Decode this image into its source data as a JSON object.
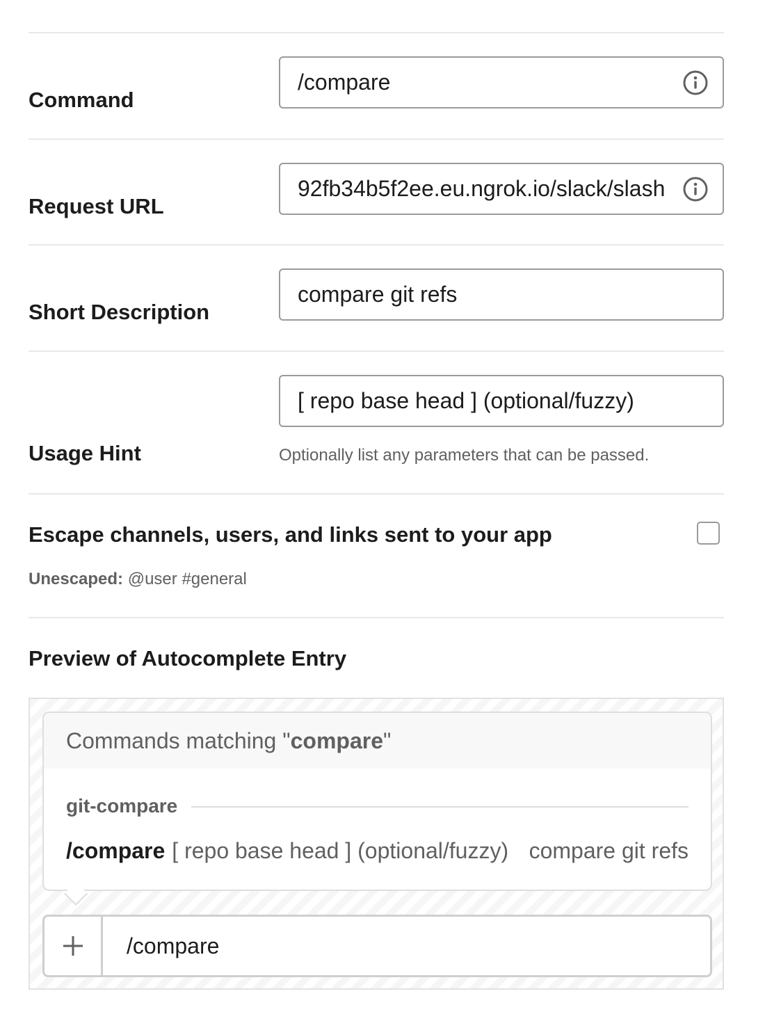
{
  "form": {
    "command": {
      "label": "Command",
      "value": "/compare"
    },
    "request_url": {
      "label": "Request URL",
      "value": "92fb34b5f2ee.eu.ngrok.io/slack/slash"
    },
    "short_description": {
      "label": "Short Description",
      "value": "compare git refs"
    },
    "usage_hint": {
      "label": "Usage Hint",
      "value": "[ repo base head ] (optional/fuzzy)",
      "help": "Optionally list any parameters that can be passed."
    },
    "escape": {
      "title": "Escape channels, users, and links sent to your app",
      "checked": false,
      "status_label": "Unescaped:",
      "status_example": "@user #general"
    }
  },
  "preview": {
    "title": "Preview of Autocomplete Entry",
    "matching_prefix": "Commands matching \"",
    "matching_term": "compare",
    "matching_suffix": "\"",
    "group_name": "git-compare",
    "entry_command": "/compare",
    "entry_hint": "[ repo base head ] (optional/fuzzy)",
    "entry_description": "compare git refs",
    "composer_text": "/compare"
  },
  "icons": {
    "info": "info-circle-icon",
    "plus": "plus-icon"
  },
  "colors": {
    "text": "#1d1c1d",
    "muted": "#616061",
    "border": "#9a9a9a"
  }
}
